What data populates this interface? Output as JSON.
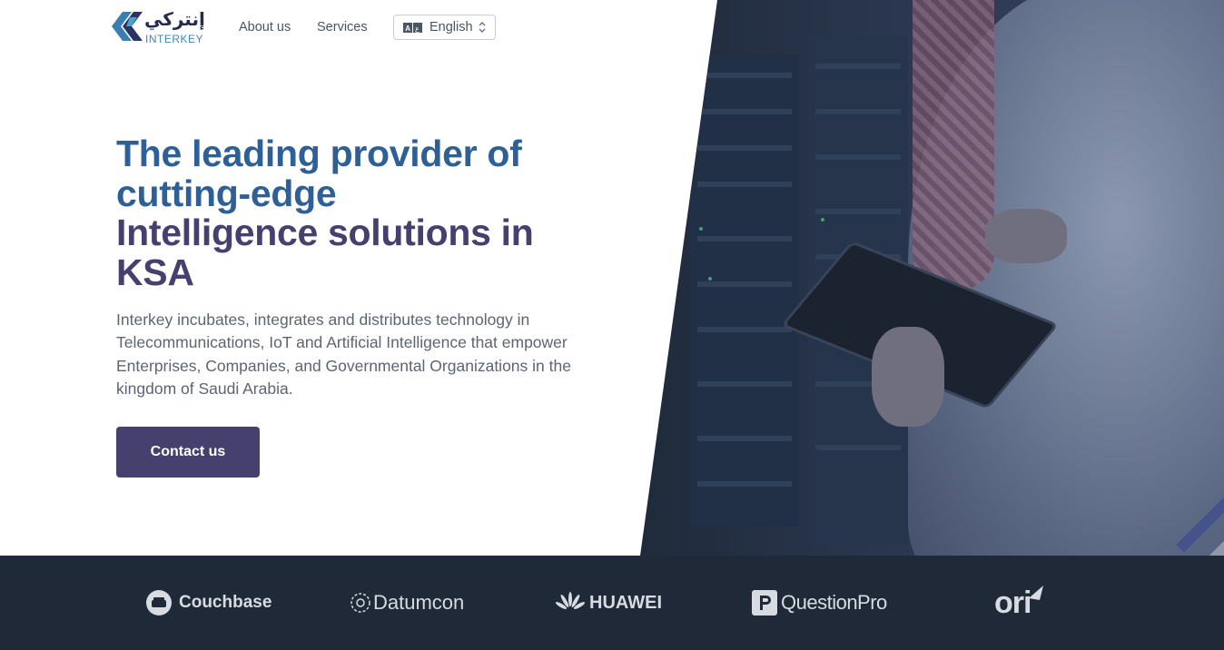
{
  "brand": {
    "arabic_name": "إنتركي",
    "name": "INTERKEY"
  },
  "nav": {
    "links": [
      {
        "label": "About us"
      },
      {
        "label": "Services"
      }
    ],
    "language": {
      "selected": "English",
      "icon": "translate-icon"
    }
  },
  "hero": {
    "title_line1": "The leading provider of",
    "title_line2": "cutting-edge",
    "title_line3": "Intelligence solutions in",
    "title_line4": "KSA",
    "description": "Interkey incubates, integrates and distributes technology in Telecommunications, IoT and Artificial Intelligence that empower Enterprises, Companies, and Governmental Organizations in the kingdom of Saudi Arabia.",
    "cta_label": "Contact us"
  },
  "partners": [
    {
      "name": "Couchbase",
      "icon": "couchbase-logo-icon"
    },
    {
      "name": "Datumcon",
      "icon": "datumcon-logo-icon"
    },
    {
      "name": "HUAWEI",
      "icon": "huawei-logo-icon"
    },
    {
      "name": "QuestionPro",
      "icon": "questionpro-logo-icon"
    },
    {
      "name": "ori",
      "icon": "ori-logo-icon"
    }
  ],
  "colors": {
    "title_blue": "#2e5f96",
    "title_purple": "#45406e",
    "cta_bg": "#45406e",
    "partners_bg": "#1f2937",
    "hero_image_overlay": "#2b3750"
  }
}
